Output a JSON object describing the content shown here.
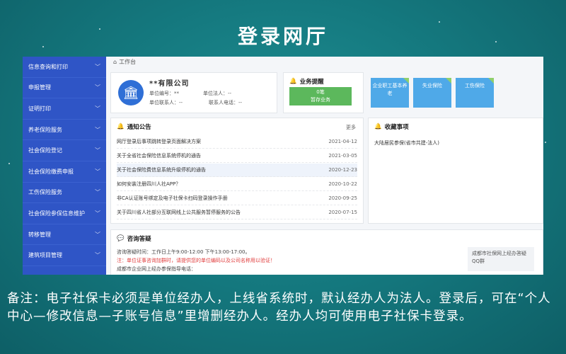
{
  "title": "登录网厅",
  "breadcrumb": {
    "home": "工作台"
  },
  "sidebar": {
    "items": [
      {
        "label": "信息查询和打印"
      },
      {
        "label": "申报管理"
      },
      {
        "label": "证明打印"
      },
      {
        "label": "养老保险服务"
      },
      {
        "label": "社会保险登记"
      },
      {
        "label": "社会保险缴费申报"
      },
      {
        "label": "工伤保险服务"
      },
      {
        "label": "社会保险参保信息维护"
      },
      {
        "label": "转移管理"
      },
      {
        "label": "建筑项目管理"
      }
    ]
  },
  "unit": {
    "name": "**有限公司",
    "id_label": "单位编号：",
    "id_value": "**",
    "legal_label": "单位法人：",
    "legal_value": "--",
    "contact_label": "单位联系人：",
    "contact_value": "--",
    "phone_label": "联系人电话：",
    "phone_value": "--"
  },
  "business": {
    "title": "业务提醒",
    "count": "0笔",
    "status": "暂存业务"
  },
  "tiles": [
    {
      "label": "企业职工基本养老"
    },
    {
      "label": "失业保险"
    },
    {
      "label": "工伤保险"
    }
  ],
  "notice": {
    "title": "通知公告",
    "more": "更多",
    "rows": [
      {
        "title": "网厅登录后事项跳转登录页面解决方案",
        "date": "2021-04-12"
      },
      {
        "title": "关于全省社会保险信息系统停机的通告",
        "date": "2021-03-05"
      },
      {
        "title": "关于社会保险费信息系统升级停机的通告",
        "date": "2020-12-23"
      },
      {
        "title": "如何安装注册四川人社APP？",
        "date": "2020-10-22"
      },
      {
        "title": "非CA认证账号绑定及电子社保卡扫码登录操作手册",
        "date": "2020-09-25"
      },
      {
        "title": "关于四川省人社部分互联网线上公共服务暂停服务的公告",
        "date": "2020-07-15"
      }
    ]
  },
  "favorites": {
    "title": "收藏事项",
    "items": [
      {
        "label": "大陆居民参保(省市共建-法人)"
      }
    ]
  },
  "faq": {
    "title": "咨询答疑",
    "hours": "咨询答疑时间：工作日上午9:00-12:00 下午13:00-17:00。",
    "warning": "注：单位证事咨询加群时，请提供您的单位编码以及公司名称用以验证！",
    "group_line": "成都市企业网上经办参保指导电话：",
    "qr_text": "成都市社保网上经办答疑QQ群"
  },
  "note": "备注：电子社保卡必须是单位经办人，上线省系统时，默认经办人为法人。登录后，可在“个人中心—修改信息—子账号信息”里增删经办人。经办人均可使用电子社保卡登录。",
  "colors": {
    "background": "#157a80",
    "sidebar": "#2f55c6",
    "tile": "#4fa9e8",
    "green": "#5cb85c",
    "warning": "#e03c3c"
  }
}
